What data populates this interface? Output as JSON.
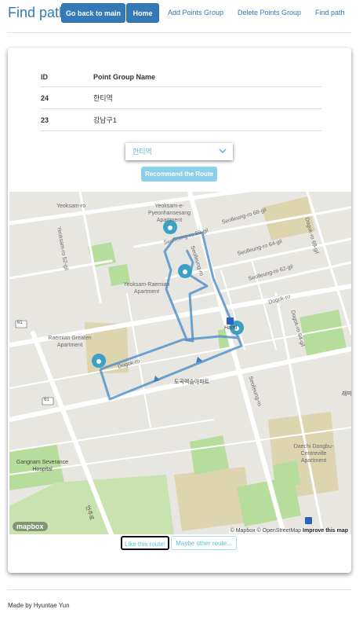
{
  "header": {
    "brand": "Find path",
    "nav": {
      "go_back": "Go back to main",
      "home": "Home",
      "add": "Add Points Group",
      "delete": "Delete Points Group",
      "find": "Find path"
    }
  },
  "table": {
    "headers": [
      "ID",
      "Point Group Name"
    ],
    "rows": [
      {
        "id": "24",
        "name": "한티역"
      },
      {
        "id": "23",
        "name": "강남구1"
      }
    ]
  },
  "select": {
    "value": "한티역"
  },
  "recommend_label": "Recommend the Route",
  "map": {
    "labels": {
      "yeoksam": "Yeoksam-ro",
      "yeoksam52": "Yeoksam-ro 52-gil",
      "pyeonhansesang": "Yeoksam-e-Pyeonhansesang Apartment",
      "raemian_yeoksam": "Yeoksam-Raemian Apartment",
      "raemian_greaten": "Raemian Greaten Apartment",
      "seolleung69": "Seolleung-ro 69-gil",
      "seolleung68": "Seolleung-ro 68-gil",
      "seolleung64": "Seolleung-ro 64-gil",
      "seolleung62": "Seolleung-ro 62-gil",
      "seolleung_a": "Seolleung-ro",
      "seolleung_b": "Seolleung-ro",
      "dogok_a": "Dogok-ro",
      "dogok_b": "Dogok-ro",
      "dogok64": "Dogok-ro 64-gil",
      "dogok69": "Dogok-ro 69-gil",
      "hanti": "Hanti",
      "dogok_apt": "도곡렉슬아파트",
      "daechi": "Daechi Dongbu-Centreville Apartment",
      "gangnam_hospital": "Gangnam Severance Hospital",
      "eonju": "언주로",
      "side_korean": "래미",
      "route_61a": "61",
      "route_61b": "61"
    },
    "attribution": "© Mapbox © OpenStreetMap",
    "improve": "Improve this map",
    "logo": "mapbox"
  },
  "buttons": {
    "like": "Like this route!",
    "other": "Maybe other route..."
  },
  "footer": "Made by Hyuntae Yun",
  "colors": {
    "primary": "#337ab7",
    "info": "#5bc0de",
    "route": "#4a8fc8",
    "marker": "#3ba1c4",
    "park": "#b7dd9c",
    "residential": "#ddd4b0"
  },
  "icons": [
    "map-marker-icon",
    "chevron-down-icon",
    "metro-icon"
  ]
}
